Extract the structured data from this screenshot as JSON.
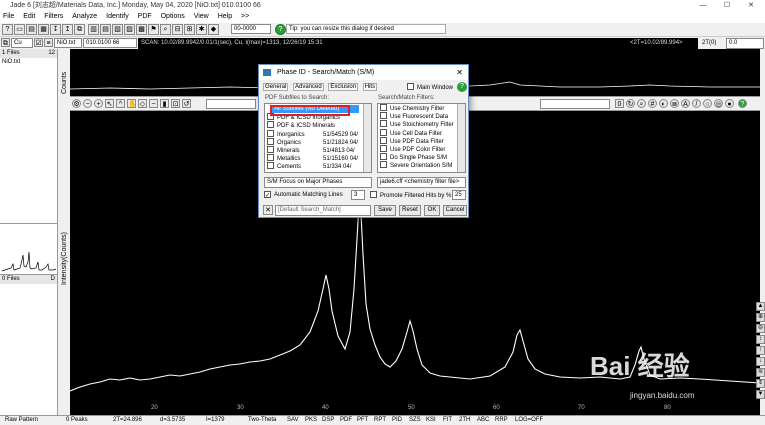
{
  "window": {
    "title": "Jade 6 [刘志超/Materials Data, Inc.] Monday, May 04, 2020 [NiO.txt] 010.0100 66",
    "minimize": "—",
    "maximize": "☐",
    "close": "✕"
  },
  "menu": [
    "File",
    "Edit",
    "Filters",
    "Analyze",
    "Identify",
    "PDF",
    "Options",
    "View",
    "Help",
    ">>"
  ],
  "toolbar": {
    "combo_value": "00-0000",
    "tip": "Tip: you can resize this dialog if desired",
    "element_combo": "Cu",
    "file_combo": "NiO.txt",
    "scan_id": "010.0100 66",
    "scan_info": "SCAN: 10.02/89.9942/0.01/1(sec), Cu, I(max)=1313, 12/26/19 15:31",
    "two_theta_readout": "<2T=10.02/89.994>",
    "twot_label": "2T(0)",
    "twot_value": "0.0"
  },
  "left_pane": {
    "files_header": "1 Files",
    "files_count": "12",
    "file_name": "NiO.txt",
    "files2_header": "0 Files",
    "files2_suffix": "D"
  },
  "plot": {
    "counts_label": "Counts",
    "intensity_label": "Intensity(Counts)",
    "x_ticks": [
      "20",
      "30",
      "40",
      "50",
      "60",
      "70",
      "80"
    ],
    "watermark": "Bai 经验",
    "watermark_url": "jingyan.baidu.com"
  },
  "dialog": {
    "title": "Phase ID - Search/Match (S/M)",
    "tabs": [
      "General",
      "Advanced",
      "Exclusion",
      "Hits"
    ],
    "main_window_label": "Main Window",
    "subfiles_label": "PDF Subfiles to Search:",
    "subfiles": [
      {
        "name": "All Subfiles (No Deleted)",
        "count": "",
        "selected": true
      },
      {
        "name": "PDF & ICSD Inorganics",
        "count": ""
      },
      {
        "name": "PDF & ICSD Minerals",
        "count": ""
      },
      {
        "name": "Inorganics",
        "count": "51/54529 04/"
      },
      {
        "name": "Organics",
        "count": "51/21824 04/"
      },
      {
        "name": "Minerals",
        "count": "51/4813 04/"
      },
      {
        "name": "Metallics",
        "count": "51/15160 04/"
      },
      {
        "name": "Cements",
        "count": "51/334 04/"
      }
    ],
    "filters_label": "Search/Match Filters:",
    "filters": [
      "Use Chemistry Filter",
      "Use Fluorescent Data",
      "Use Stoichiometry Filter",
      "Use Cell Data Filter",
      "Use PDF Data Filter",
      "Use PDF Color Filter",
      "Do Single Phase S/M",
      "Severe Orientation S/M"
    ],
    "focus_select": "S/M Focus on Major Phases",
    "filter_file_select": "jade6.cff <chemistry filter file>",
    "auto_lines_label": "Automatic Matching Lines",
    "auto_lines_value": "3",
    "promote_label": "Promote Filtered Hits by %",
    "promote_value": "25",
    "default_combo": "[Default Search_Match]",
    "buttons": {
      "save": "Save",
      "reset": "Reset",
      "ok": "OK",
      "cancel": "Cancel"
    }
  },
  "status": {
    "mode": "Raw Pattern",
    "peaks": "0 Peaks",
    "two_theta": "2T=24.896",
    "d": "d=3.5735",
    "i": "I=1379",
    "axis": "Two-Theta",
    "tools": [
      "SAV",
      "PKS",
      "DSP",
      "PDF",
      "PFT",
      "RPT",
      "PID",
      "SZS",
      "KSI",
      "FIT",
      "2TH",
      "ABC",
      "RRP",
      "LOG=OFF"
    ]
  },
  "colors": {
    "highlight": "#3399ff",
    "red_box": "#e02020",
    "plot_bg": "#000000",
    "pattern": "#ffffff"
  }
}
